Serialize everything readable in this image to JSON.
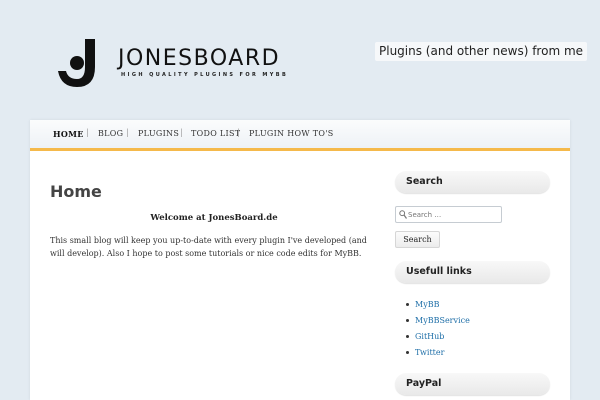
{
  "header": {
    "logo_word": "JONESBOARD",
    "logo_tagline": "HIGH QUALITY PLUGINS FOR MYBB",
    "tagline": "Plugins (and other news) from me"
  },
  "nav": {
    "items": [
      {
        "label": "HOME",
        "active": true
      },
      {
        "label": "BLOG"
      },
      {
        "label": "PLUGINS"
      },
      {
        "label": "TODO LIST"
      },
      {
        "label": "PLUGIN HOW TO'S"
      }
    ],
    "separator": "|"
  },
  "main": {
    "title": "Home",
    "welcome": "Welcome at JonesBoard.de",
    "intro": "This small blog will keep you up-to-date with every plugin I've developed (and will develop). Also I hope to post some tutorials or nice code edits for MyBB."
  },
  "sidebar": {
    "search_title": "Search",
    "search_placeholder": "Search …",
    "search_button": "Search",
    "links_title": "Usefull links",
    "links": [
      "MyBB",
      "MyBBService",
      "GitHub",
      "Twitter"
    ],
    "paypal_title": "PayPal"
  },
  "colors": {
    "accent": "#f5b94b",
    "link": "#1f6fa8",
    "background": "#e3ebf2"
  }
}
